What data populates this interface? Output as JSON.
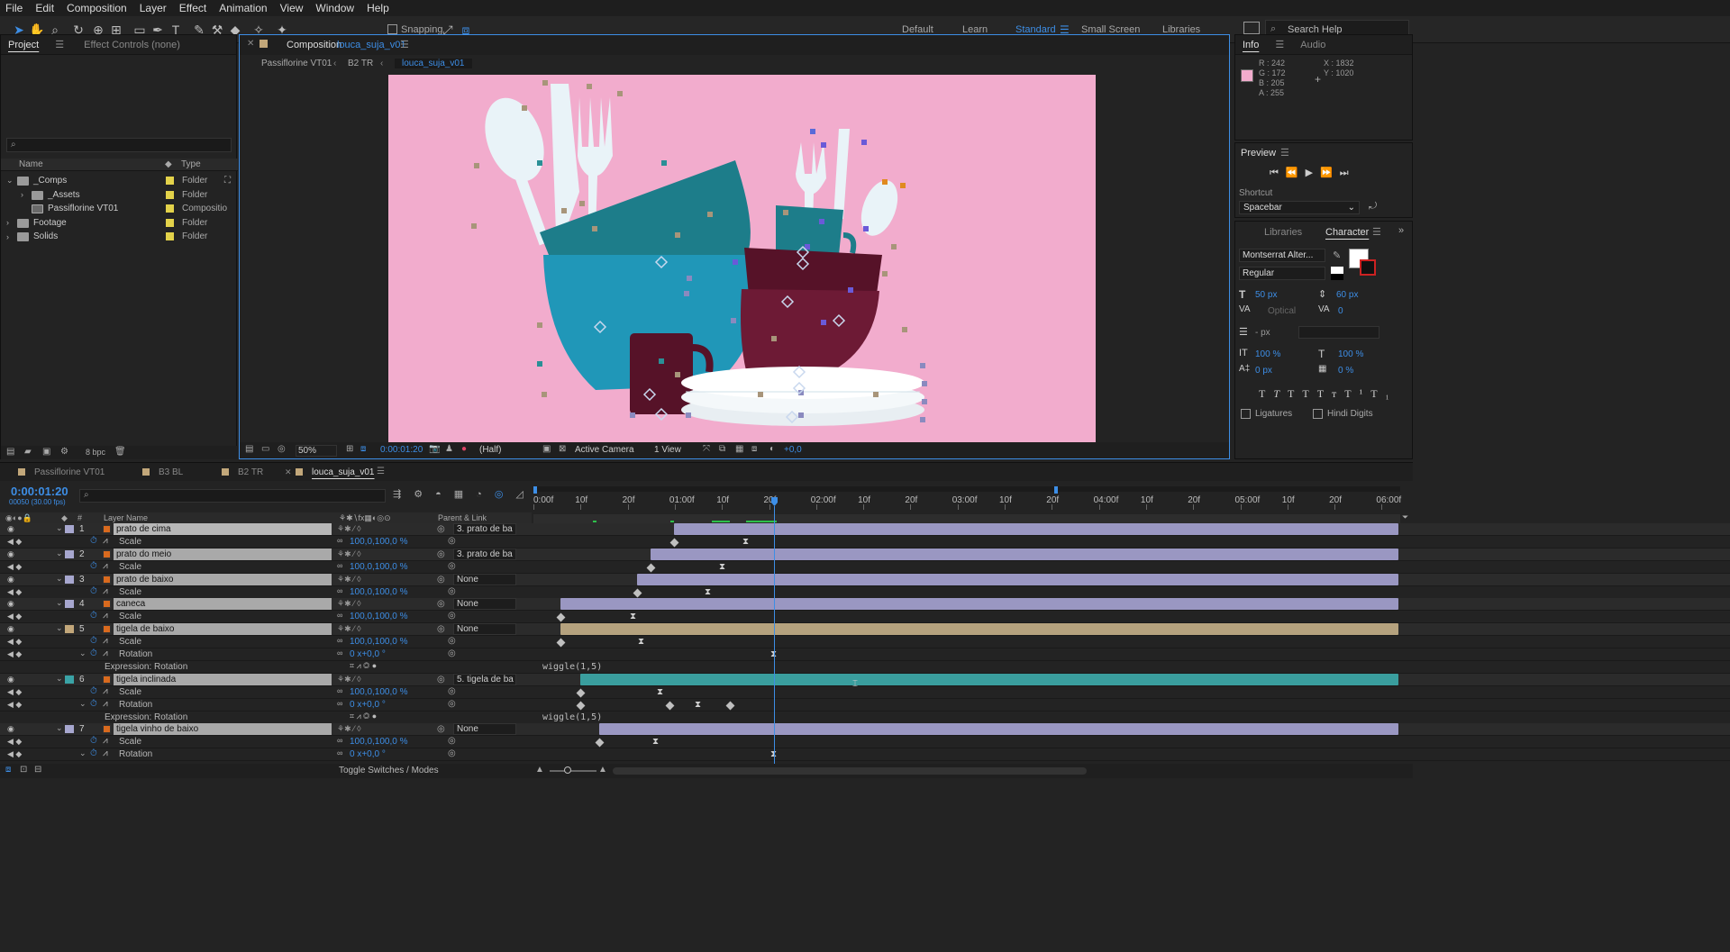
{
  "menu": [
    "File",
    "Edit",
    "Composition",
    "Layer",
    "Effect",
    "Animation",
    "View",
    "Window",
    "Help"
  ],
  "toolbar": {
    "snapping": "Snapping"
  },
  "workspaces": [
    "Default",
    "Learn",
    "Standard",
    "Small Screen",
    "Libraries"
  ],
  "search_help": "Search Help",
  "project": {
    "tab": "Project",
    "effect_controls": "Effect Controls (none)",
    "search_placeholder": "",
    "col_name": "Name",
    "col_type": "Type",
    "items": [
      {
        "name": "_Comps",
        "type": "Folder",
        "indent": 0
      },
      {
        "name": "_Assets",
        "type": "Folder",
        "indent": 1
      },
      {
        "name": "Passiflorine VT01",
        "type": "Compositio",
        "indent": 1
      },
      {
        "name": "Footage",
        "type": "Folder",
        "indent": 0
      },
      {
        "name": "Solids",
        "type": "Folder",
        "indent": 0
      }
    ],
    "bpc": "8 bpc"
  },
  "composition": {
    "tab_label": "Composition",
    "comp_name": "louca_suja_v01",
    "breadcrumbs": [
      "Passiflorine VT01",
      "B2 TR",
      "louca_suja_v01"
    ],
    "zoom": "50%",
    "timecode": "0:00:01:20",
    "resolution": "(Half)",
    "camera": "Active Camera",
    "views": "1 View",
    "exposure": "+0,0"
  },
  "info": {
    "tab": "Info",
    "audio": "Audio",
    "r": "R : 242",
    "g": "G : 172",
    "b": "B : 205",
    "a": "A : 255",
    "x": "X : 1832",
    "y": "Y : 1020",
    "swatch": "#f2accd"
  },
  "preview": {
    "title": "Preview",
    "shortcut_label": "Shortcut",
    "shortcut": "Spacebar"
  },
  "character": {
    "libraries": "Libraries",
    "title": "Character",
    "font": "Montserrat Alter...",
    "style": "Regular",
    "size": "50 px",
    "leading": "60 px",
    "kerning": "Optical",
    "tracking": "0",
    "stroke": "- px",
    "vscale": "100 %",
    "hscale": "100 %",
    "baseline": "0 px",
    "tsume": "0 %",
    "ligatures": "Ligatures",
    "hindi": "Hindi Digits"
  },
  "timeline": {
    "tabs": [
      "Passiflorine VT01",
      "B3 BL",
      "B2 TR",
      "louca_suja_v01"
    ],
    "timecode": "0:00:01:20",
    "fps": "00050 (30.00 fps)",
    "col_layer": "Layer Name",
    "col_parent": "Parent & Link",
    "ruler": [
      "0:00f",
      "10f",
      "20f",
      "01:00f",
      "10f",
      "20f",
      "02:00f",
      "10f",
      "20f",
      "03:00f",
      "10f",
      "20f",
      "04:00f",
      "10f",
      "20f",
      "05:00f",
      "10f",
      "20f",
      "06:00f"
    ],
    "toggle": "Toggle Switches / Modes",
    "rows": [
      {
        "kind": "layer",
        "num": "1",
        "name": "prato de cima",
        "parent": "3. prato de ba",
        "color": "#a7a7cf",
        "bar_start": 748,
        "bar_color": "#9a97c2",
        "sel": true
      },
      {
        "kind": "prop",
        "name": "Scale",
        "value": "100,0,100,0 %",
        "keys": [
          748
        ],
        "hg": [
          827
        ]
      },
      {
        "kind": "layer",
        "num": "2",
        "name": "prato do meio",
        "parent": "3. prato de ba",
        "color": "#a7a7cf",
        "bar_start": 722,
        "bar_color": "#9a97c2"
      },
      {
        "kind": "prop",
        "name": "Scale",
        "value": "100,0,100,0 %",
        "keys": [
          722
        ],
        "hg": [
          801
        ]
      },
      {
        "kind": "layer",
        "num": "3",
        "name": "prato de baixo",
        "parent": "None",
        "color": "#a7a7cf",
        "bar_start": 707,
        "bar_color": "#9a97c2"
      },
      {
        "kind": "prop",
        "name": "Scale",
        "value": "100,0,100,0 %",
        "keys": [
          707
        ],
        "hg": [
          785
        ]
      },
      {
        "kind": "layer",
        "num": "4",
        "name": "caneca",
        "parent": "None",
        "color": "#a7a7cf",
        "bar_start": 622,
        "bar_color": "#9a97c2"
      },
      {
        "kind": "prop",
        "name": "Scale",
        "value": "100,0,100,0 %",
        "keys": [
          622
        ],
        "hg": [
          702
        ]
      },
      {
        "kind": "layer",
        "num": "5",
        "name": "tigela de baixo",
        "parent": "None",
        "color": "#c2a77a",
        "bar_start": 622,
        "bar_color": "#b5a27e"
      },
      {
        "kind": "prop",
        "name": "Scale",
        "value": "100,0,100,0 %",
        "keys": [
          622
        ],
        "hg": [
          711
        ]
      },
      {
        "kind": "prop",
        "name": "Rotation",
        "value": "0 x+0,0 °",
        "keys": [],
        "hg": [
          858
        ]
      },
      {
        "kind": "expr",
        "name": "Expression: Rotation",
        "expr": "wiggle(1,5)"
      },
      {
        "kind": "layer",
        "num": "6",
        "name": "tigela inclinada",
        "parent": "5. tigela de ba",
        "color": "#3aa3a6",
        "bar_start": 644,
        "bar_color": "#3a9e9e"
      },
      {
        "kind": "prop",
        "name": "Scale",
        "value": "100,0,100,0 %",
        "keys": [
          644
        ],
        "hg": [
          732
        ]
      },
      {
        "kind": "prop",
        "name": "Rotation",
        "value": "0 x+0,0 °",
        "keys": [
          644,
          743,
          810
        ],
        "hg": [
          774
        ]
      },
      {
        "kind": "expr",
        "name": "Expression: Rotation",
        "expr": "wiggle(1,5)"
      },
      {
        "kind": "layer",
        "num": "7",
        "name": "tigela vinho de baixo",
        "parent": "None",
        "color": "#a7a7cf",
        "bar_start": 665,
        "bar_color": "#9a97c2"
      },
      {
        "kind": "prop",
        "name": "Scale",
        "value": "100,0,100,0 %",
        "keys": [
          665
        ],
        "hg": [
          727
        ]
      },
      {
        "kind": "prop",
        "name": "Rotation",
        "value": "0 x+0,0 °",
        "keys": [],
        "hg": [
          858
        ]
      }
    ]
  },
  "colors": {
    "bg": "#f2accd",
    "accent": "#3d8ee6",
    "teal": "#1d7d8a",
    "cyan": "#2097b8",
    "wine": "#6d1a35",
    "wine_dark": "#561228"
  }
}
